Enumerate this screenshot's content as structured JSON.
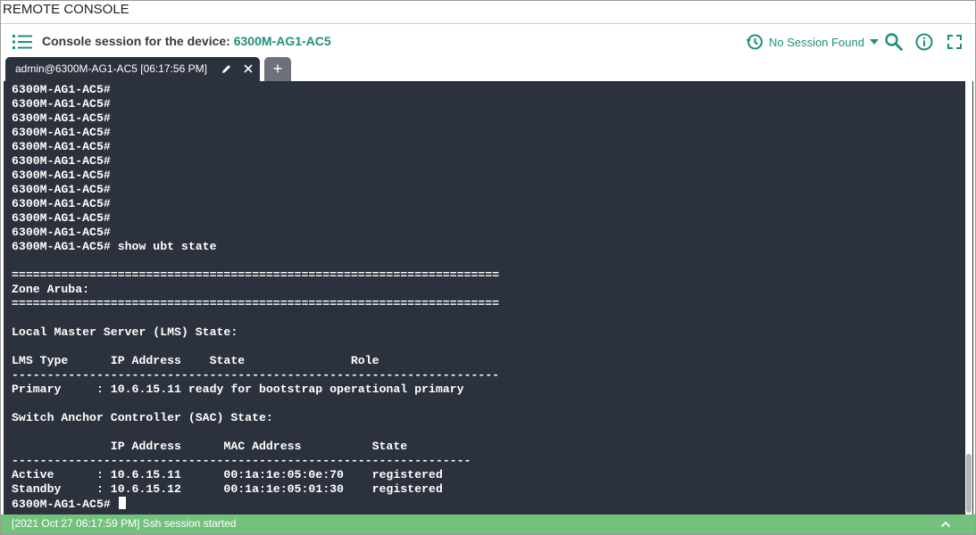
{
  "window": {
    "title": "REMOTE CONSOLE"
  },
  "header": {
    "prefix": "Console session for the device: ",
    "device": "6300M-AG1-AC5",
    "session_status": "No Session Found",
    "icons": [
      "list-menu-icon",
      "history-icon",
      "search-icon",
      "info-icon",
      "fullscreen-icon"
    ]
  },
  "tabs": [
    {
      "label": "admin@6300M-AG1-AC5 [06:17:56 PM]",
      "active": true
    }
  ],
  "add_tab_label": "+",
  "terminal": {
    "lines": [
      "6300M-AG1-AC5#",
      "6300M-AG1-AC5#",
      "6300M-AG1-AC5#",
      "6300M-AG1-AC5#",
      "6300M-AG1-AC5#",
      "6300M-AG1-AC5#",
      "6300M-AG1-AC5#",
      "6300M-AG1-AC5#",
      "6300M-AG1-AC5#",
      "6300M-AG1-AC5#",
      "6300M-AG1-AC5#",
      "6300M-AG1-AC5# show ubt state",
      "",
      "=====================================================================",
      "Zone Aruba:",
      "=====================================================================",
      "",
      "Local Master Server (LMS) State:",
      "",
      "LMS Type      IP Address    State               Role",
      "---------------------------------------------------------------------",
      "Primary     : 10.6.15.11 ready for bootstrap operational primary",
      "",
      "Switch Anchor Controller (SAC) State:",
      "",
      "              IP Address      MAC Address          State",
      "-----------------------------------------------------------------",
      "Active      : 10.6.15.11      00:1a:1e:05:0e:70    registered",
      "Standby     : 10.6.15.12      00:1a:1e:05:01:30    registered"
    ],
    "prompt": "6300M-AG1-AC5# "
  },
  "status": {
    "message": "[2021 Oct 27 06:17:59 PM] Ssh session started"
  },
  "colors": {
    "accent": "#1f8f7a",
    "terminal_bg": "#2b313d",
    "status_bg": "#74c17d"
  }
}
